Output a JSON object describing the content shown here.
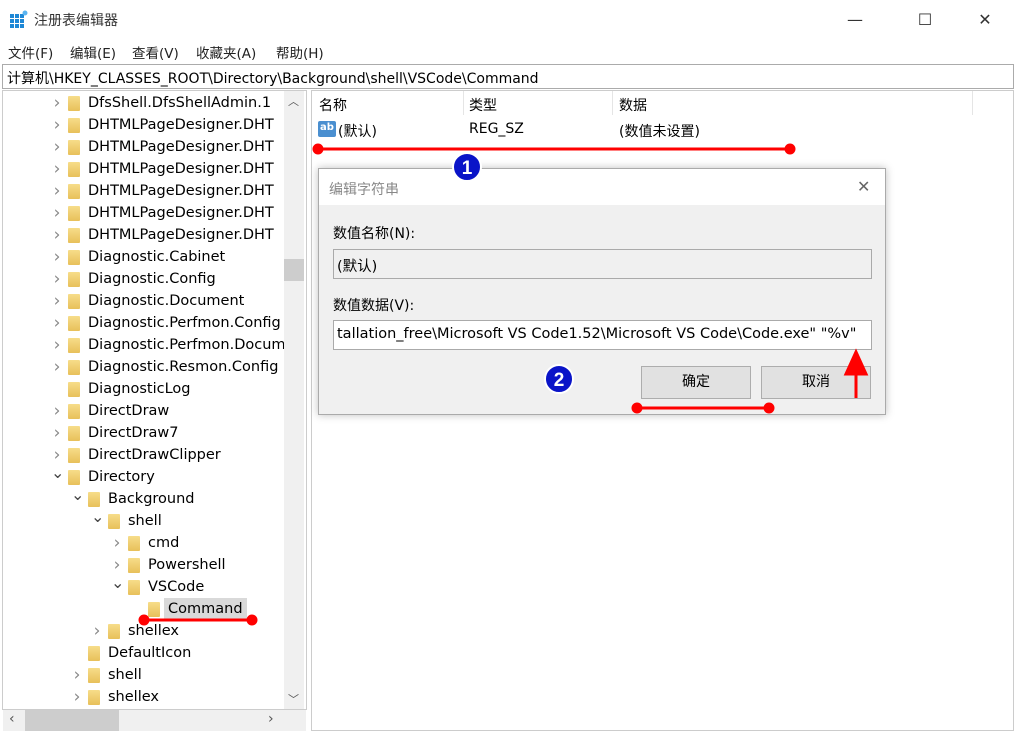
{
  "window": {
    "title": "注册表编辑器",
    "minimize": "—",
    "maximize": "☐",
    "close": "✕"
  },
  "menu": [
    "文件(F)",
    "编辑(E)",
    "查看(V)",
    "收藏夹(A)",
    "帮助(H)"
  ],
  "address": "计算机\\HKEY_CLASSES_ROOT\\Directory\\Background\\shell\\VSCode\\Command",
  "tree": [
    {
      "label": "DfsShell.DfsShellAdmin.1",
      "level": 0,
      "state": "collapsed"
    },
    {
      "label": "DHTMLPageDesigner.DHT",
      "level": 0,
      "state": "collapsed"
    },
    {
      "label": "DHTMLPageDesigner.DHT",
      "level": 0,
      "state": "collapsed"
    },
    {
      "label": "DHTMLPageDesigner.DHT",
      "level": 0,
      "state": "collapsed"
    },
    {
      "label": "DHTMLPageDesigner.DHT",
      "level": 0,
      "state": "collapsed"
    },
    {
      "label": "DHTMLPageDesigner.DHT",
      "level": 0,
      "state": "collapsed"
    },
    {
      "label": "DHTMLPageDesigner.DHT",
      "level": 0,
      "state": "collapsed"
    },
    {
      "label": "Diagnostic.Cabinet",
      "level": 0,
      "state": "collapsed"
    },
    {
      "label": "Diagnostic.Config",
      "level": 0,
      "state": "collapsed"
    },
    {
      "label": "Diagnostic.Document",
      "level": 0,
      "state": "collapsed"
    },
    {
      "label": "Diagnostic.Perfmon.Config",
      "level": 0,
      "state": "collapsed"
    },
    {
      "label": "Diagnostic.Perfmon.Docum",
      "level": 0,
      "state": "collapsed"
    },
    {
      "label": "Diagnostic.Resmon.Config",
      "level": 0,
      "state": "collapsed"
    },
    {
      "label": "DiagnosticLog",
      "level": 0,
      "state": "leaf"
    },
    {
      "label": "DirectDraw",
      "level": 0,
      "state": "collapsed"
    },
    {
      "label": "DirectDraw7",
      "level": 0,
      "state": "collapsed"
    },
    {
      "label": "DirectDrawClipper",
      "level": 0,
      "state": "collapsed"
    },
    {
      "label": "Directory",
      "level": 0,
      "state": "expanded"
    },
    {
      "label": "Background",
      "level": 1,
      "state": "expanded"
    },
    {
      "label": "shell",
      "level": 2,
      "state": "expanded"
    },
    {
      "label": "cmd",
      "level": 3,
      "state": "collapsed"
    },
    {
      "label": "Powershell",
      "level": 3,
      "state": "collapsed"
    },
    {
      "label": "VSCode",
      "level": 3,
      "state": "expanded"
    },
    {
      "label": "Command",
      "level": 4,
      "state": "leaf",
      "selected": true
    },
    {
      "label": "shellex",
      "level": 2,
      "state": "collapsed"
    },
    {
      "label": "DefaultIcon",
      "level": 1,
      "state": "leaf"
    },
    {
      "label": "shell",
      "level": 1,
      "state": "collapsed"
    },
    {
      "label": "shellex",
      "level": 1,
      "state": "collapsed"
    }
  ],
  "list": {
    "columns": [
      "名称",
      "类型",
      "数据"
    ],
    "rows": [
      {
        "name": "(默认)",
        "type": "REG_SZ",
        "data": "(数值未设置)",
        "icon": "string-value-icon"
      }
    ]
  },
  "dialog": {
    "title": "编辑字符串",
    "name_label": "数值名称(N):",
    "name_value": "(默认)",
    "data_label": "数值数据(V):",
    "data_value": "tallation_free\\Microsoft VS Code1.52\\Microsoft VS Code\\Code.exe\" \"%v\"",
    "ok": "确定",
    "cancel": "取消",
    "close": "✕"
  },
  "annotations": {
    "badge1": "1",
    "badge2": "2",
    "color_line": "#ff0000",
    "color_badge": "#0a14c8"
  }
}
